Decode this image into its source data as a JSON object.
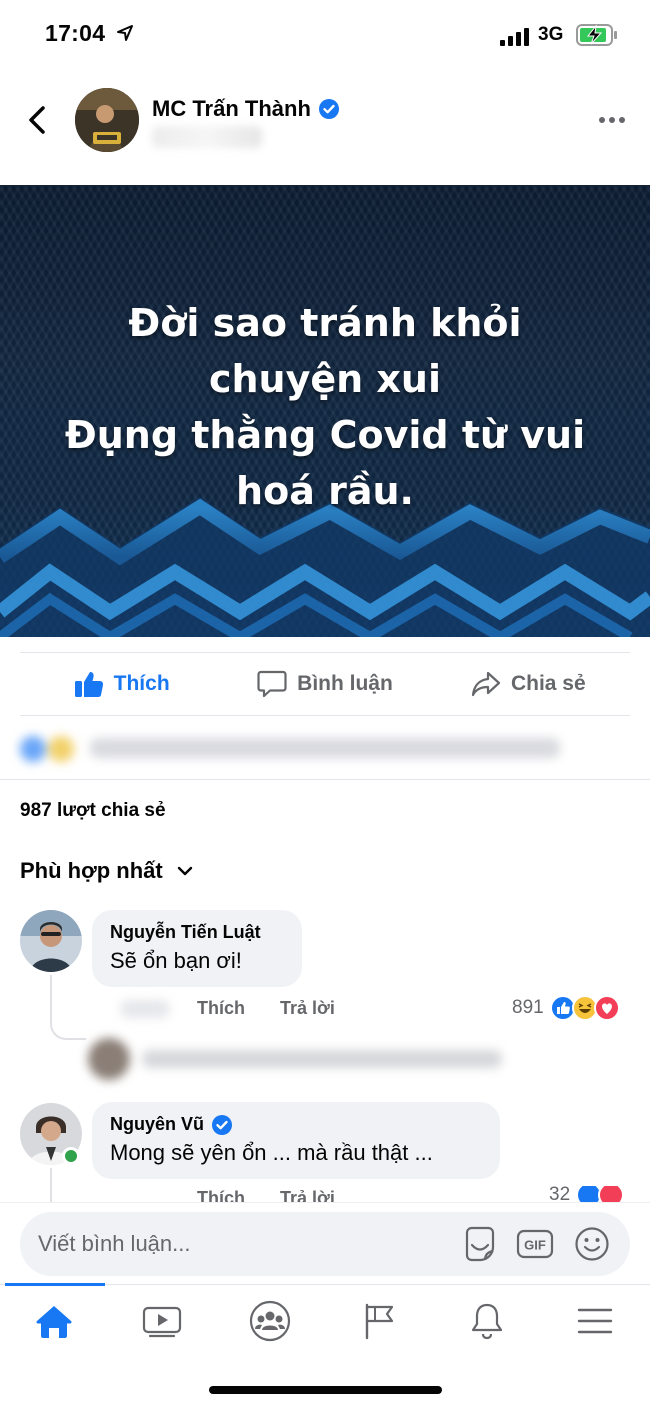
{
  "status_bar": {
    "time": "17:04",
    "network": "3G"
  },
  "header": {
    "page_name": "MC Trấn Thành"
  },
  "banner": {
    "lines": [
      "Đời sao tránh khỏi",
      "chuyện xui",
      "Đụng thằng Covid từ vui",
      "hoá rầu."
    ]
  },
  "actions": {
    "like": "Thích",
    "comment": "Bình luận",
    "share": "Chia sẻ"
  },
  "shares_text": "987 lượt chia sẻ",
  "sort_label": "Phù hợp nhất",
  "comments": [
    {
      "name": "Nguyễn Tiến Luật",
      "text": "Sẽ ổn bạn ơi!",
      "like": "Thích",
      "reply": "Trả lời",
      "reaction_count": "891"
    },
    {
      "name": "Nguyên Vũ",
      "text": "Mong sẽ yên ổn ... mà rầu thật ...",
      "like": "Thích",
      "reply": "Trả lời",
      "reaction_count": "32"
    }
  ],
  "composer": {
    "placeholder": "Viết bình luận...",
    "gif_label": "GIF"
  },
  "tabs": [
    "home-icon",
    "watch-icon",
    "groups-icon",
    "pages-icon",
    "notifications-icon",
    "menu-icon"
  ],
  "colors": {
    "accent": "#1877f2",
    "banner_bg": "#12263f",
    "online": "#31a24c"
  }
}
